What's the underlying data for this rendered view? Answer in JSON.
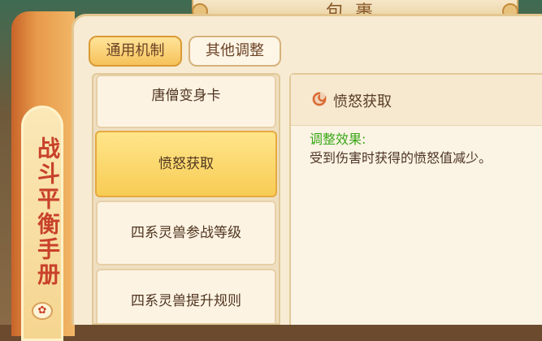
{
  "header": {
    "title": "包裹"
  },
  "side_tab": {
    "label": "战斗平衡手册"
  },
  "tabs": [
    {
      "label": "通用机制",
      "active": true
    },
    {
      "label": "其他调整",
      "active": false
    }
  ],
  "list_items": [
    {
      "label": "唐僧变身卡"
    },
    {
      "label": "愤怒获取",
      "selected": true
    },
    {
      "label": "四系灵兽参战等级"
    },
    {
      "label": "四系灵兽提升规则"
    }
  ],
  "detail": {
    "title": "愤怒获取",
    "icon": "swirl-icon",
    "effect_label": "调整效果:",
    "effect_text": "受到伤害时获得的愤怒值减少。"
  },
  "colors": {
    "accent_green": "#3aa818",
    "tab_active": "#f6c25a",
    "side_label": "#c8412a"
  }
}
